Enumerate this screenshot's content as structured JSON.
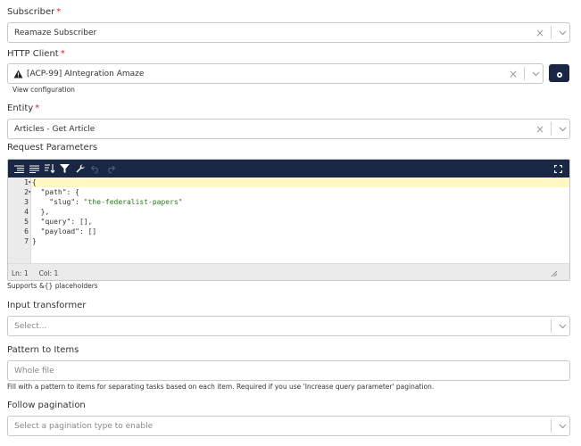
{
  "subscriber": {
    "label": "Subscriber",
    "required": "*",
    "value": "Reamaze Subscriber"
  },
  "http_client": {
    "label": "HTTP Client",
    "required": "*",
    "value": "[ACP-99] AIntegration Amaze",
    "link": "View configuration"
  },
  "entity": {
    "label": "Entity",
    "required": "*",
    "value": "Articles - Get Article"
  },
  "request_parameters": {
    "label": "Request Parameters",
    "line_numbers": [
      "1",
      "2",
      "3",
      "4",
      "5",
      "6",
      "7"
    ],
    "code_lines": [
      "{",
      "  \"path\": {",
      "    \"slug\": \"the-federalist-papers\"",
      "  },",
      "  \"query\": [],",
      "  \"payload\": []",
      "}"
    ],
    "status_ln": "Ln: 1",
    "status_col": "Col: 1",
    "helper": "Supports &{} placeholders"
  },
  "input_transformer": {
    "label": "Input transformer",
    "placeholder": "Select..."
  },
  "pattern_to_items": {
    "label": "Pattern to Items",
    "placeholder": "Whole file",
    "helper": "Fill with a pattern to items for separating tasks based on each item. Required if you use 'Increase query parameter' pagination."
  },
  "follow_pagination": {
    "label": "Follow pagination",
    "placeholder": "Select a pagination type to enable"
  },
  "colors": {
    "toolbar": "#1a2744",
    "required": "#d9232e",
    "string": "#2a7b24",
    "active_line": "#fff8c5"
  }
}
